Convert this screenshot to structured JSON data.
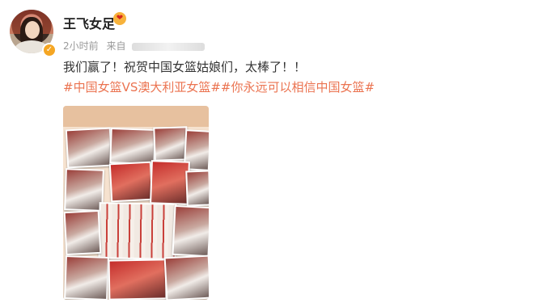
{
  "user": {
    "name": "王飞女足",
    "verified": true,
    "medal_icon": "medal-icon"
  },
  "meta": {
    "time": "2小时前",
    "source_prefix": "来自"
  },
  "post": {
    "text": "我们赢了！祝贺中国女篮姑娘们，太棒了！！",
    "hashtags": [
      "#中国女篮VS澳大利亚女篮#",
      "#你永远可以相信中国女篮#"
    ]
  },
  "colors": {
    "link": "#eb7350",
    "name": "#222222",
    "meta": "#999999",
    "verified_badge": "#f5a623"
  }
}
